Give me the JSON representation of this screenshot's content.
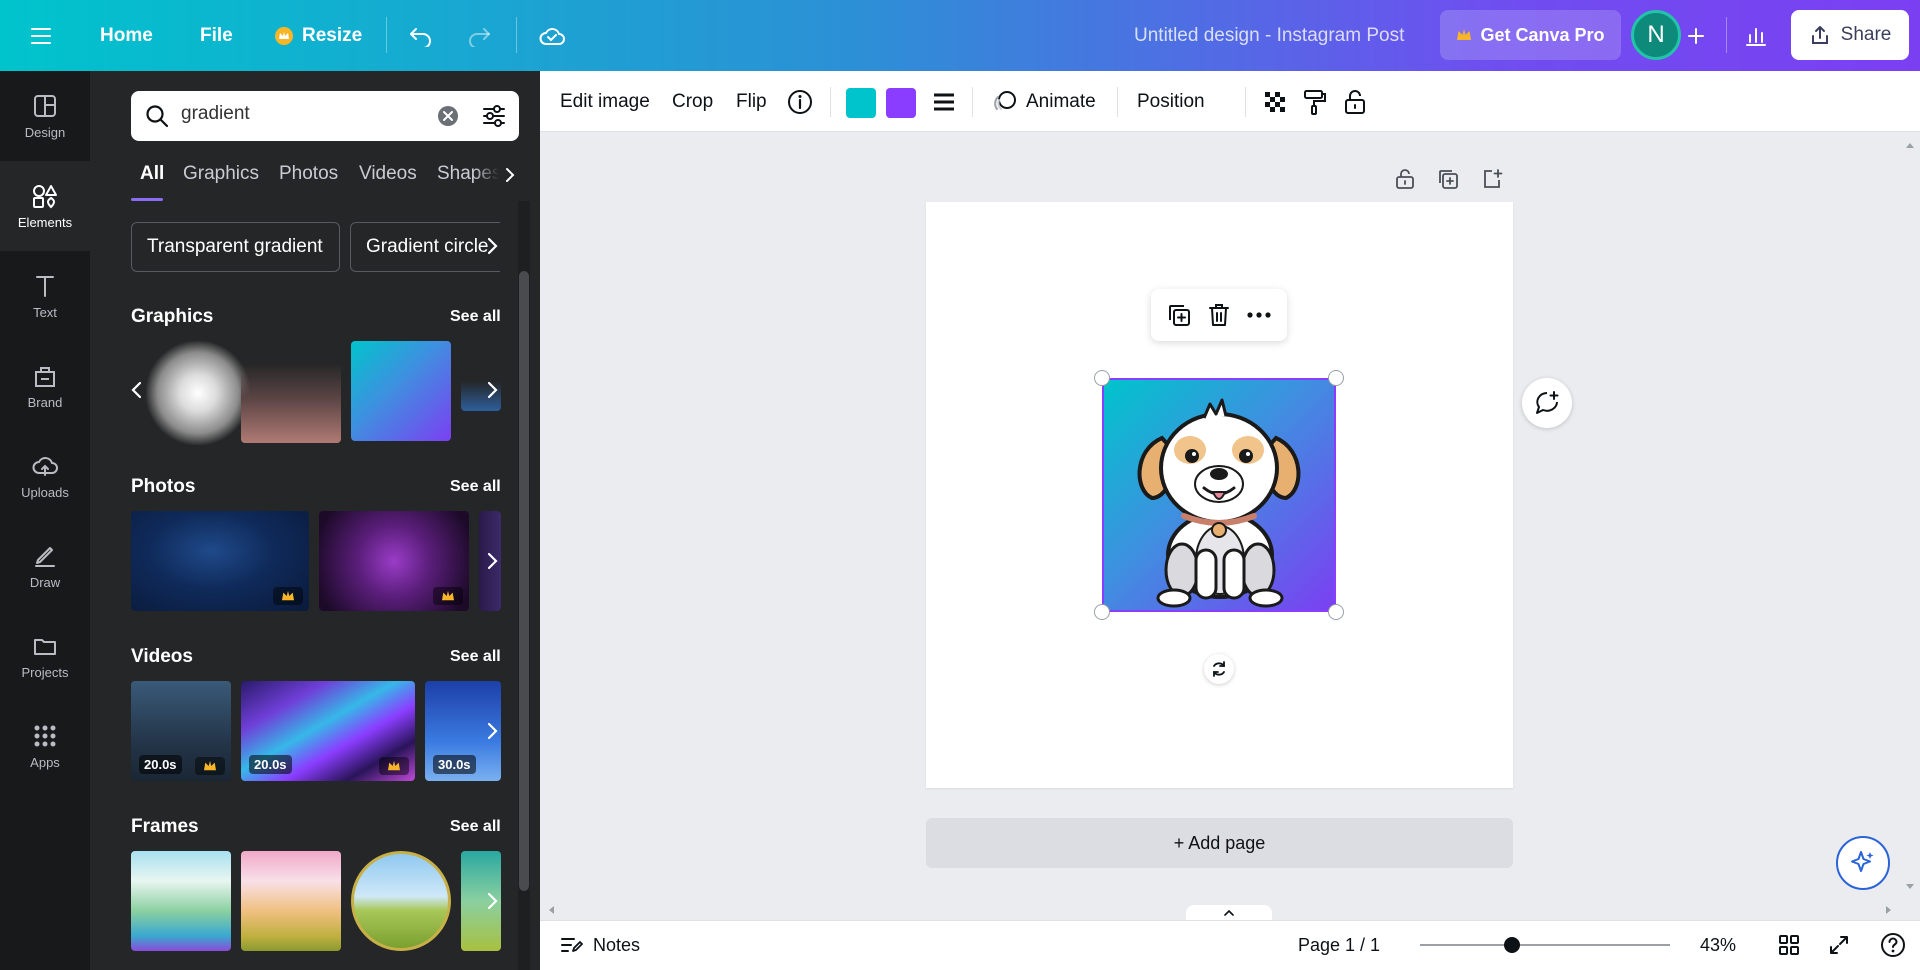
{
  "topbar": {
    "home": "Home",
    "file": "File",
    "resize": "Resize",
    "doc_title": "Untitled design - Instagram Post",
    "get_pro": "Get Canva Pro",
    "avatar_initial": "N",
    "share": "Share"
  },
  "rail": {
    "items": [
      {
        "label": "Design",
        "icon": "design-icon"
      },
      {
        "label": "Elements",
        "icon": "elements-icon"
      },
      {
        "label": "Text",
        "icon": "text-icon"
      },
      {
        "label": "Brand",
        "icon": "brand-icon"
      },
      {
        "label": "Uploads",
        "icon": "uploads-icon"
      },
      {
        "label": "Draw",
        "icon": "draw-icon"
      },
      {
        "label": "Projects",
        "icon": "projects-icon"
      },
      {
        "label": "Apps",
        "icon": "apps-icon"
      }
    ]
  },
  "panel": {
    "search_value": "gradient",
    "tabs": [
      "All",
      "Graphics",
      "Photos",
      "Videos",
      "Shapes"
    ],
    "chips": [
      "Transparent gradient",
      "Gradient circle"
    ],
    "see_all": "See all",
    "sections": {
      "graphics": "Graphics",
      "photos": "Photos",
      "videos": "Videos",
      "frames": "Frames"
    },
    "videos": [
      {
        "duration": "20.0s"
      },
      {
        "duration": "20.0s"
      },
      {
        "duration": "30.0s"
      }
    ]
  },
  "context_toolbar": {
    "edit_image": "Edit image",
    "crop": "Crop",
    "flip": "Flip",
    "color1": "#00c4cc",
    "color2": "#8b3dff",
    "animate": "Animate",
    "position": "Position"
  },
  "canvas": {
    "add_page": "+ Add page"
  },
  "footer": {
    "notes": "Notes",
    "page": "Page 1 / 1",
    "zoom": "43%",
    "zoom_level": 0.43
  }
}
